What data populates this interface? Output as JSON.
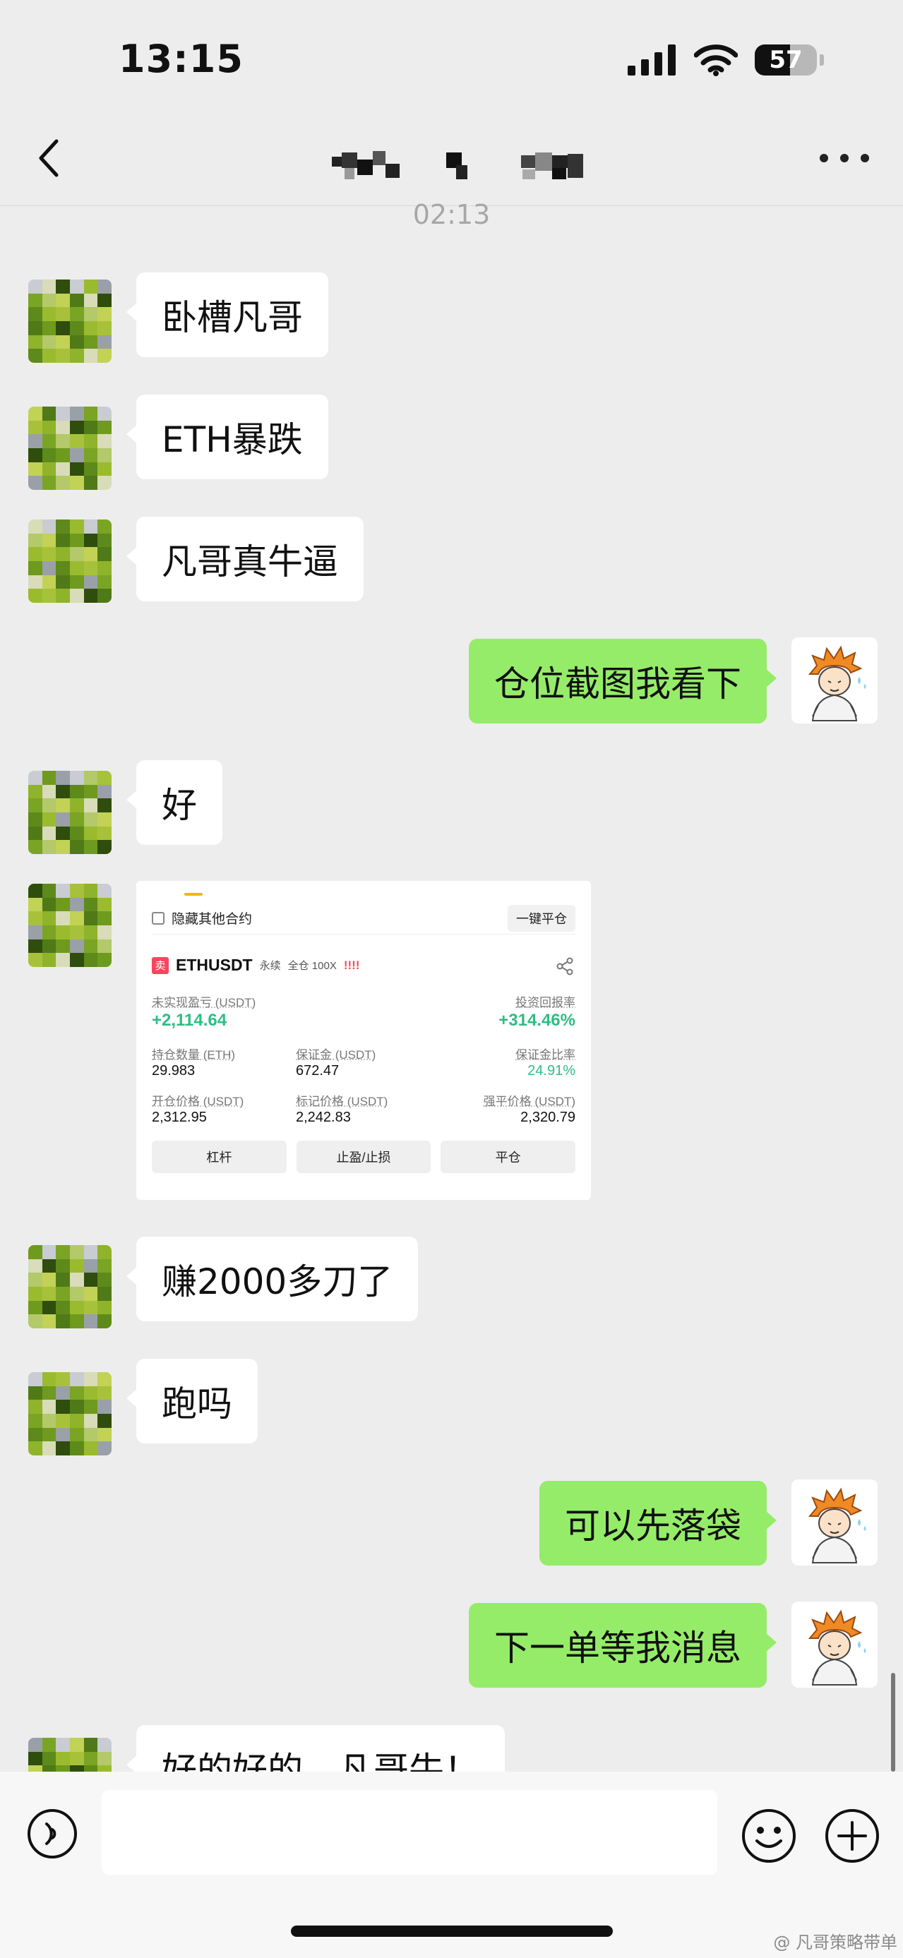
{
  "status_bar": {
    "time": "13:15",
    "battery": "57",
    "battery_level": 0.57
  },
  "nav": {
    "title": ""
  },
  "timestamp": "02:13",
  "messages": [
    {
      "side": "left",
      "text": "卧槽凡哥"
    },
    {
      "side": "left",
      "text": "ETH暴跌"
    },
    {
      "side": "left",
      "text": "凡哥真牛逼"
    },
    {
      "side": "right",
      "text": "仓位截图我看下"
    },
    {
      "side": "left",
      "text": "好"
    },
    {
      "side": "left",
      "text": "赚2000多刀了"
    },
    {
      "side": "left",
      "text": "跑吗"
    },
    {
      "side": "right",
      "text": "可以先落袋"
    },
    {
      "side": "right",
      "text": "下一单等我消息"
    },
    {
      "side": "left",
      "text": "好的好的，凡哥牛！"
    }
  ],
  "screenshot": {
    "hide_other_label": "隐藏其他合约",
    "close_all_label": "一键平仓",
    "side_badge": "卖",
    "symbol": "ETHUSDT",
    "contract_type": "永续",
    "margin_mode": "全仓 100X",
    "warning": "!!!!",
    "unrealized_pnl_label": "未实现盈亏 (USDT)",
    "unrealized_pnl": "+2,114.64",
    "roi_label": "投资回报率",
    "roi": "+314.46%",
    "size_label": "持仓数量 (ETH)",
    "size": "29.983",
    "margin_label": "保证金 (USDT)",
    "margin": "672.47",
    "margin_ratio_label": "保证金比率",
    "margin_ratio": "24.91%",
    "entry_label": "开仓价格 (USDT)",
    "entry": "2,312.95",
    "mark_label": "标记价格 (USDT)",
    "mark": "2,242.83",
    "liq_label": "强平价格 (USDT)",
    "liq": "2,320.79",
    "btn_leverage": "杠杆",
    "btn_tpsl": "止盈/止损",
    "btn_close": "平仓"
  },
  "input": {
    "placeholder": ""
  },
  "watermark": "@ 凡哥策略带单",
  "colors": {
    "bubble_mine": "#95ec69",
    "bubble_other": "#ffffff",
    "background": "#ededed",
    "profit_green": "#2ebd85",
    "sell_red": "#f6465d"
  }
}
